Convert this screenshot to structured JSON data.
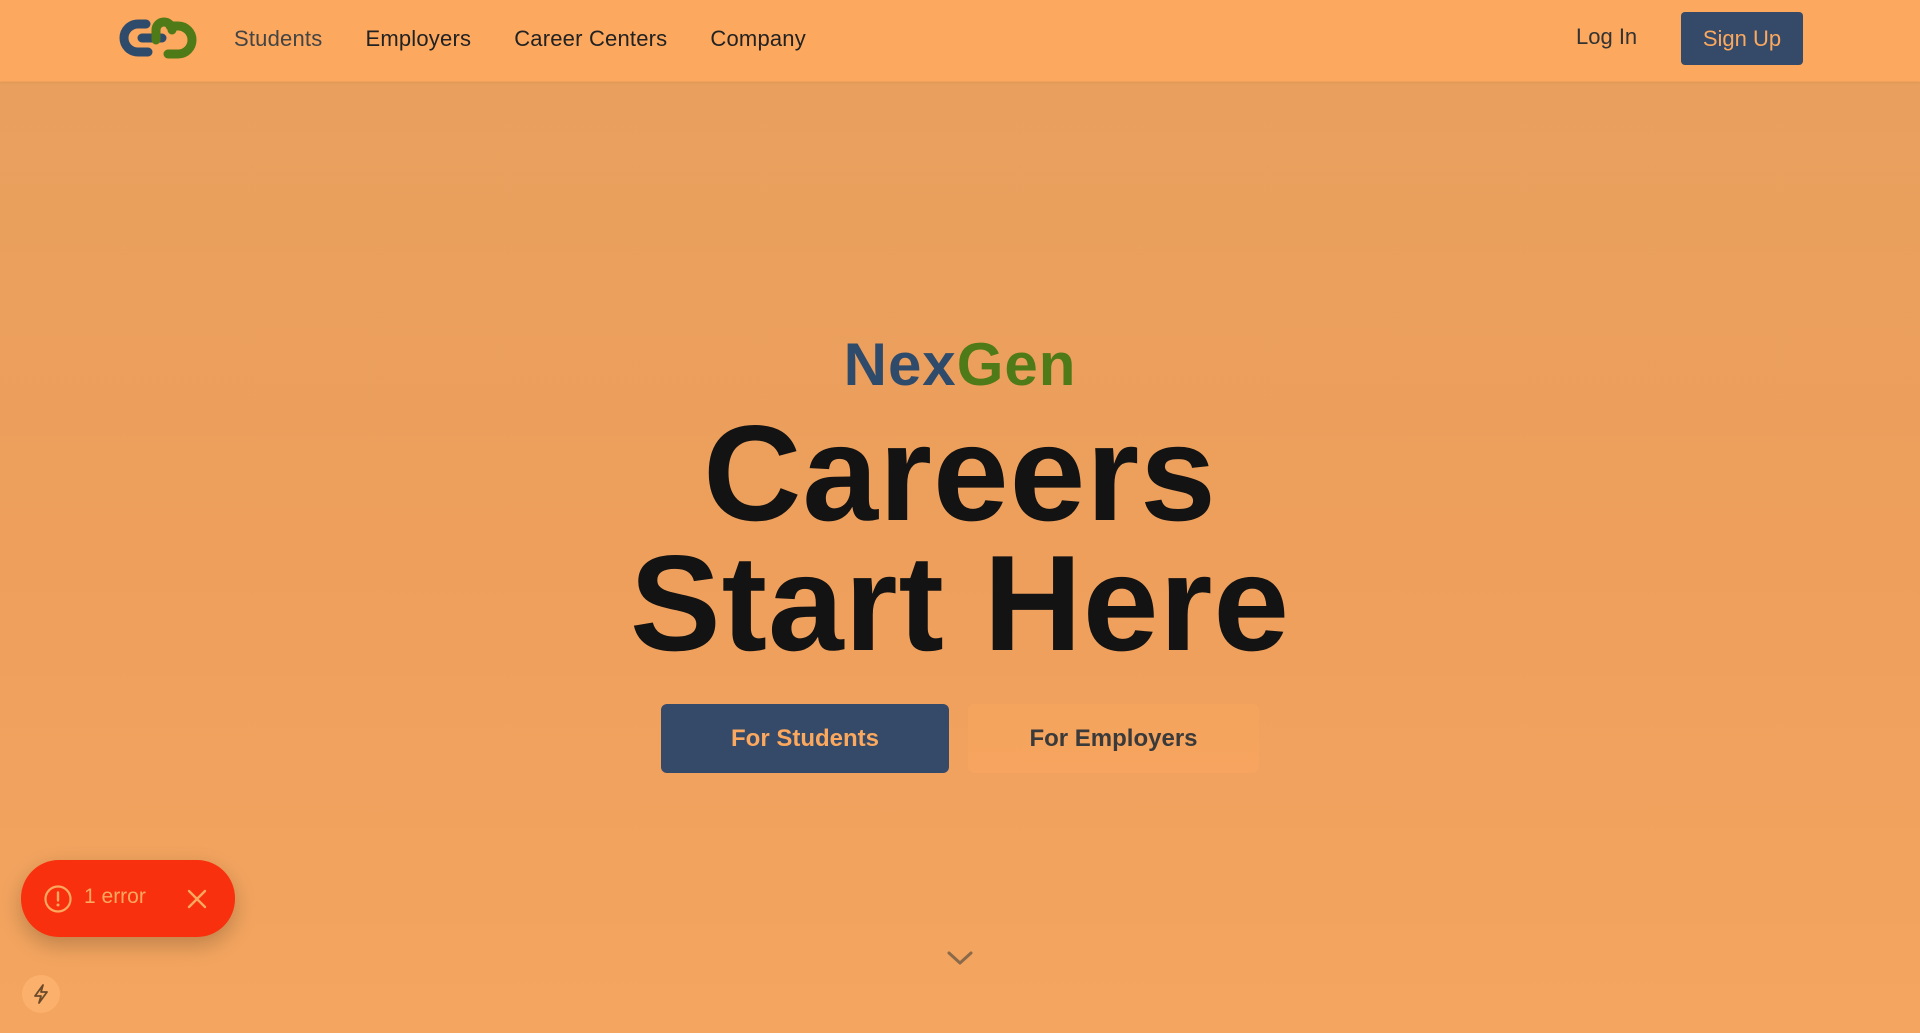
{
  "header": {
    "logo_icon": "chain-link-logo-icon",
    "nav": [
      {
        "label": "Students"
      },
      {
        "label": "Employers"
      },
      {
        "label": "Career Centers"
      },
      {
        "label": "Company"
      }
    ],
    "login_label": "Log In",
    "signup_label": "Sign Up"
  },
  "hero": {
    "brand_part1": "Nex",
    "brand_part2": "Gen",
    "headline_line1": "Careers",
    "headline_line2": "Start Here",
    "primary_button": "For Students",
    "secondary_button": "For Employers",
    "scroll_icon": "chevron-down-icon"
  },
  "dev_overlay": {
    "error_label": "1 error",
    "error_icon": "alert-circle-icon",
    "close_icon": "close-icon",
    "bolt_icon": "bolt-icon"
  },
  "colors": {
    "page_background": "#fca85e",
    "brand_blue": "#2f4b6b",
    "brand_green": "#4e7a17",
    "button_dark": "#344a68",
    "error_red": "#f9300e"
  }
}
